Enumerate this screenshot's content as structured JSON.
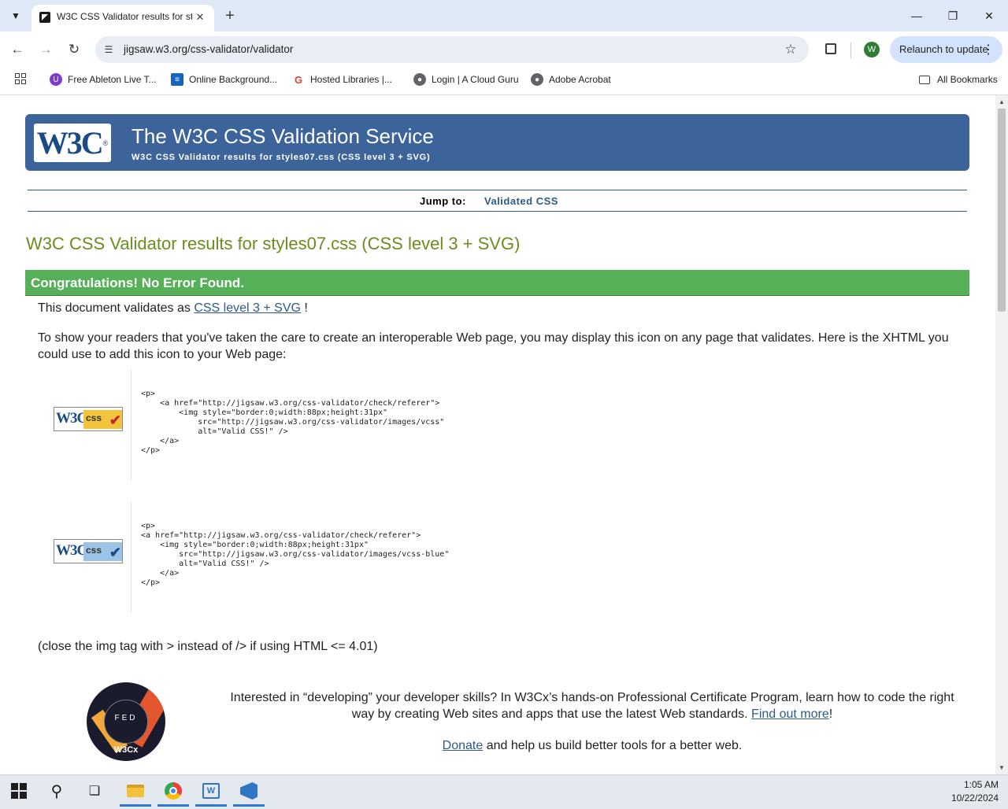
{
  "browser": {
    "tab_title": "W3C CSS Validator results for st",
    "url": "jigsaw.w3.org/css-validator/validator",
    "relaunch_label": "Relaunch to update",
    "profile_initial": "W",
    "bookmarks": [
      {
        "label": "Free Ableton Live T...",
        "icon": "ableton-icon"
      },
      {
        "label": "Online Background...",
        "icon": "online-background-icon"
      },
      {
        "label": "Hosted Libraries  |...",
        "icon": "google-icon"
      },
      {
        "label": "Login | A Cloud Guru",
        "icon": "globe-icon"
      },
      {
        "label": "Adobe Acrobat",
        "icon": "globe-icon"
      }
    ],
    "all_bookmarks_label": "All Bookmarks"
  },
  "page": {
    "banner_title": "The W3C CSS Validation Service",
    "banner_subtitle": "W3C CSS Validator results for styles07.css (CSS level 3 + SVG)",
    "logo_text": "W3C",
    "logo_reg": "®",
    "jump_label": "Jump to:",
    "jump_link": "Validated CSS",
    "results_heading": "W3C CSS Validator results for styles07.css (CSS level 3 + SVG)",
    "congrats": "Congratulations! No Error Found.",
    "validates_prefix": "This document validates as ",
    "validates_link": "CSS level 3 + SVG",
    "validates_suffix": " !",
    "icon_paragraph": "To show your readers that you've taken the care to create an interoperable Web page, you may display this icon on any page that validates. Here is the XHTML you could use to add this icon to your Web page:",
    "badge_w3c": "W3C",
    "badge_css": "css",
    "badge_check": "✔",
    "code_gold": "<p>\n    <a href=\"http://jigsaw.w3.org/css-validator/check/referer\">\n        <img style=\"border:0;width:88px;height:31px\"\n            src=\"http://jigsaw.w3.org/css-validator/images/vcss\"\n            alt=\"Valid CSS!\" />\n    </a>\n</p>",
    "code_blue": "<p>\n<a href=\"http://jigsaw.w3.org/css-validator/check/referer\">\n    <img style=\"border:0;width:88px;height:31px\"\n        src=\"http://jigsaw.w3.org/css-validator/images/vcss-blue\"\n        alt=\"Valid CSS!\" />\n    </a>\n</p>",
    "closing_note": "(close the img tag with > instead of /> if using HTML <= 4.01)",
    "badge_round_label": "W3Cx",
    "badge_round_letters": "FED",
    "promo_text": "Interested in “developing” your developer skills? In W3Cx’s hands-on Professional Certificate Program, learn how to code the right way by creating Web sites and apps that use the latest Web standards.",
    "promo_link": "Find out more",
    "promo_suffix": "!",
    "donate_link": "Donate",
    "donate_suffix": " and help us build better tools for a better web."
  },
  "taskbar": {
    "time": "1:05 AM",
    "date": "10/22/2024"
  },
  "colors": {
    "banner": "#3d639b",
    "congrats": "#56b058",
    "heading": "#6c8c1e",
    "link": "#2e5a87"
  }
}
